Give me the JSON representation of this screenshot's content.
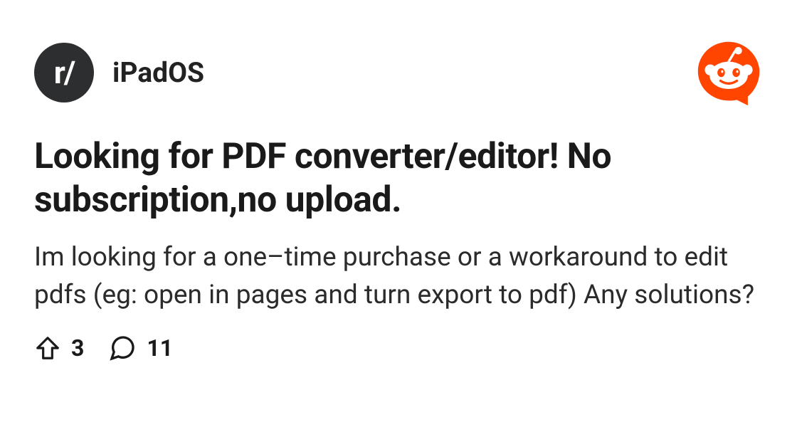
{
  "subreddit": {
    "icon_text": "r/",
    "name": "iPadOS"
  },
  "post": {
    "title": "Looking for PDF converter/editor! No subscription,no upload.",
    "body": "Im looking for a one–time purchase or a workaround to edit pdfs (eg: open in pages and turn export to pdf) Any solutions?",
    "upvotes": "3",
    "comments": "11"
  }
}
